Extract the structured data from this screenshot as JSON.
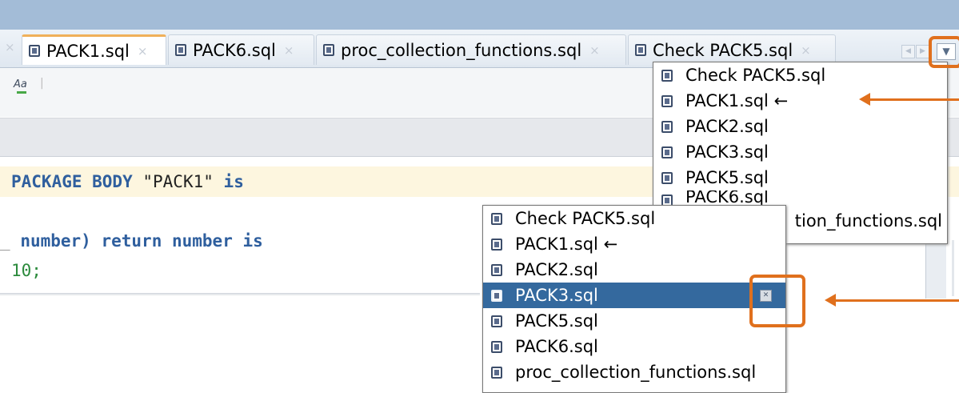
{
  "tabs": [
    {
      "label": "PACK1.sql",
      "active": true
    },
    {
      "label": "PACK6.sql",
      "active": false
    },
    {
      "label": "proc_collection_functions.sql",
      "active": false
    },
    {
      "label": "Check PACK5.sql",
      "active": false
    }
  ],
  "tab_close_glyph": "×",
  "toolbar": {
    "aa_label": "Aa",
    "separator": "|"
  },
  "code": {
    "line1": {
      "kw1": "PACKAGE BODY",
      "str": "\"PACK1\"",
      "kw2": "is"
    },
    "line2": {
      "lead": "_",
      "kw1": "number)",
      "kw2": "return number is"
    },
    "line3": {
      "num": "10;"
    }
  },
  "menu_large": {
    "items": [
      "Check PACK5.sql",
      "PACK1.sql ←",
      "PACK2.sql",
      "PACK3.sql",
      "PACK5.sql",
      "PACK6.sql",
      "proc_collection_functions.sql"
    ],
    "visible_tail": "tion_functions.sql"
  },
  "menu_small": {
    "items": [
      "Check PACK5.sql",
      "PACK1.sql ←",
      "PACK2.sql",
      "PACK3.sql",
      "PACK5.sql",
      "PACK6.sql",
      "proc_collection_functions.sql"
    ],
    "selected_index": 3
  },
  "colors": {
    "annotation": "#e0701d",
    "selection": "#34699e",
    "titlebar": "#a3bcd7"
  },
  "icons": [
    "file-icon",
    "close-icon",
    "dropdown-arrow-icon",
    "scroll-left-icon",
    "scroll-right-icon",
    "match-case-icon"
  ]
}
